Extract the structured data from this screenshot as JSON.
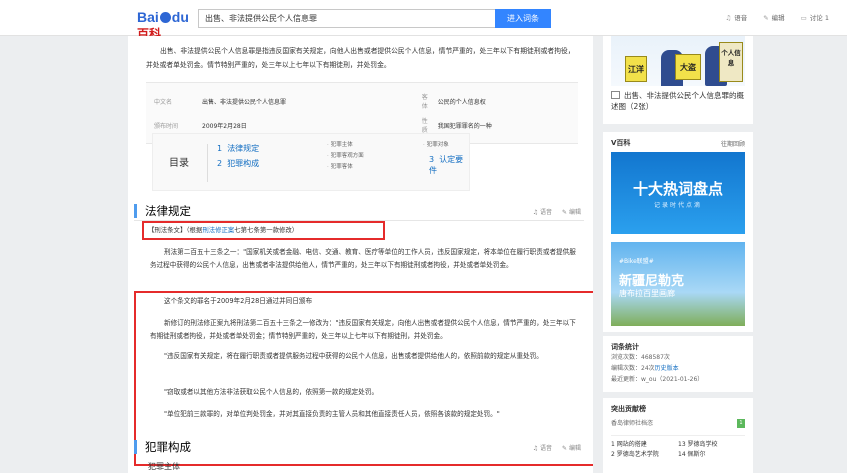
{
  "header": {
    "logo_a": "Bai",
    "logo_b": "du",
    "logo_c": "百科",
    "search_value": "出售、非法提供公民个人信息罪",
    "search_button": "进入词条",
    "links": [
      {
        "icon": "headphones-icon",
        "label": "语音"
      },
      {
        "icon": "edit-icon",
        "label": "编辑"
      },
      {
        "icon": "discuss-icon",
        "label": "讨论 1"
      }
    ]
  },
  "intro": "出售、非法提供公民个人信息罪是指违反国家有关规定，向他人出售或者提供公民个人信息，情节严重的，处三年以下有期徒刑或者拘役，并处或者单处罚金。情节特别严重的，处三年以上七年以下有期徒刑，并处罚金。",
  "basic_info": [
    {
      "k1": "中文名",
      "v1": "出售、非法提供公民个人信息罪",
      "k2": "客　体",
      "v2": "公民的个人信息权"
    },
    {
      "k1": "颁布时间",
      "v1": "2009年2月28日",
      "k2": "性　质",
      "v2": "我国犯罪罪名的一种"
    }
  ],
  "toc": {
    "title": "目录",
    "items": [
      {
        "num": "1",
        "label": "法律规定"
      },
      {
        "num": "2",
        "label": "犯罪构成"
      },
      {
        "num": "3",
        "label": "认定要件"
      }
    ],
    "subs": [
      "犯罪主体",
      "犯罪客观方面",
      "犯罪客体",
      "犯罪对象"
    ]
  },
  "section1": {
    "title": "法律规定",
    "tools": [
      "语音",
      "编辑"
    ],
    "tag_prefix": "【刑法条文】（根据",
    "tag_link": "刑法修正案",
    "tag_suffix": "七第七条第一款修改）",
    "p1": "刑法第二百五十三条之一：\"国家机关或者金融、电信、交通、教育、医疗等单位的工作人员，违反国家规定，将本单位在履行职责或者提供服务过程中获得的公民个人信息，出售或者非法提供给他人，情节严重的，处三年以下有期徒刑或者拘役，并处或者单处罚金。",
    "p2": "这个条文的罪名于2009年2月28日通过并同日颁布",
    "p3": "新修订的刑法修正案九将刑法第二百五十三条之一修改为：\"违反国家有关规定，向他人出售或者提供公民个人信息，情节严重的，处三年以下有期徒刑或者拘役，并处或者单处罚金；情节特别严重的，处三年以上七年以下有期徒刑，并处罚金。",
    "p4": "\"违反国家有关规定，将在履行职责或者提供服务过程中获得的公民个人信息，出售或者提供给他人的，依照前款的规定从重处罚。",
    "p5": "\"窃取或者以其他方法非法获取公民个人信息的，依照第一款的规定处罚。",
    "p6": "\"单位犯前三款罪的，对单位判处罚金，并对其直接负责的主管人员和其他直接责任人员，依照各该款的规定处罚。\""
  },
  "section2": {
    "title": "犯罪构成",
    "tools": [
      "语音",
      "编辑"
    ],
    "sub": "犯罪主体"
  },
  "side": {
    "img_signs": [
      "江洋",
      "大盗",
      "个人信息"
    ],
    "img_caption": "出售、非法提供公民个人信息罪的概述图（2张）",
    "vbaike_title": "V百科",
    "vbaike_more": "往期回顾",
    "banner1_title": "十大热词盘点",
    "banner1_sub": "记录时代点滴",
    "banner2_tag": "#Bike联盟#",
    "banner2_title": "新疆尼勒克",
    "banner2_sub": "唐布拉百里画廊",
    "stats_title": "词条统计",
    "stats": [
      {
        "label": "浏览次数：",
        "value": "468587次"
      },
      {
        "label": "编辑次数：",
        "value": "24次",
        "link": "历史版本"
      },
      {
        "label": "最近更新：",
        "value": "w_ou（2021-01-26）"
      }
    ],
    "contrib_title": "突出贡献榜",
    "contrib_item": "香岛律师社档恣",
    "contrib_badge": "1",
    "contrib_list": [
      "1 网站的搭建",
      "2 罗德岛艺术学院",
      "13 罗德岛学校",
      "14 佩斯尔"
    ],
    "colors": {
      "accent": "#3385ff",
      "link": "#136ec2",
      "highlight": "#e52b2b",
      "banner1": "#1f8fe0",
      "banner2": "#4aa3e8"
    }
  }
}
